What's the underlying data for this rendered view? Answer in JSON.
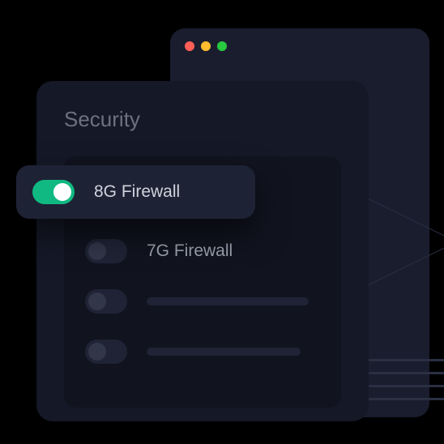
{
  "panel": {
    "title": "Security",
    "options": [
      {
        "label": "8G Firewall",
        "enabled": true
      },
      {
        "label": "7G Firewall",
        "enabled": false
      }
    ]
  },
  "colors": {
    "accent": "#10b981"
  }
}
